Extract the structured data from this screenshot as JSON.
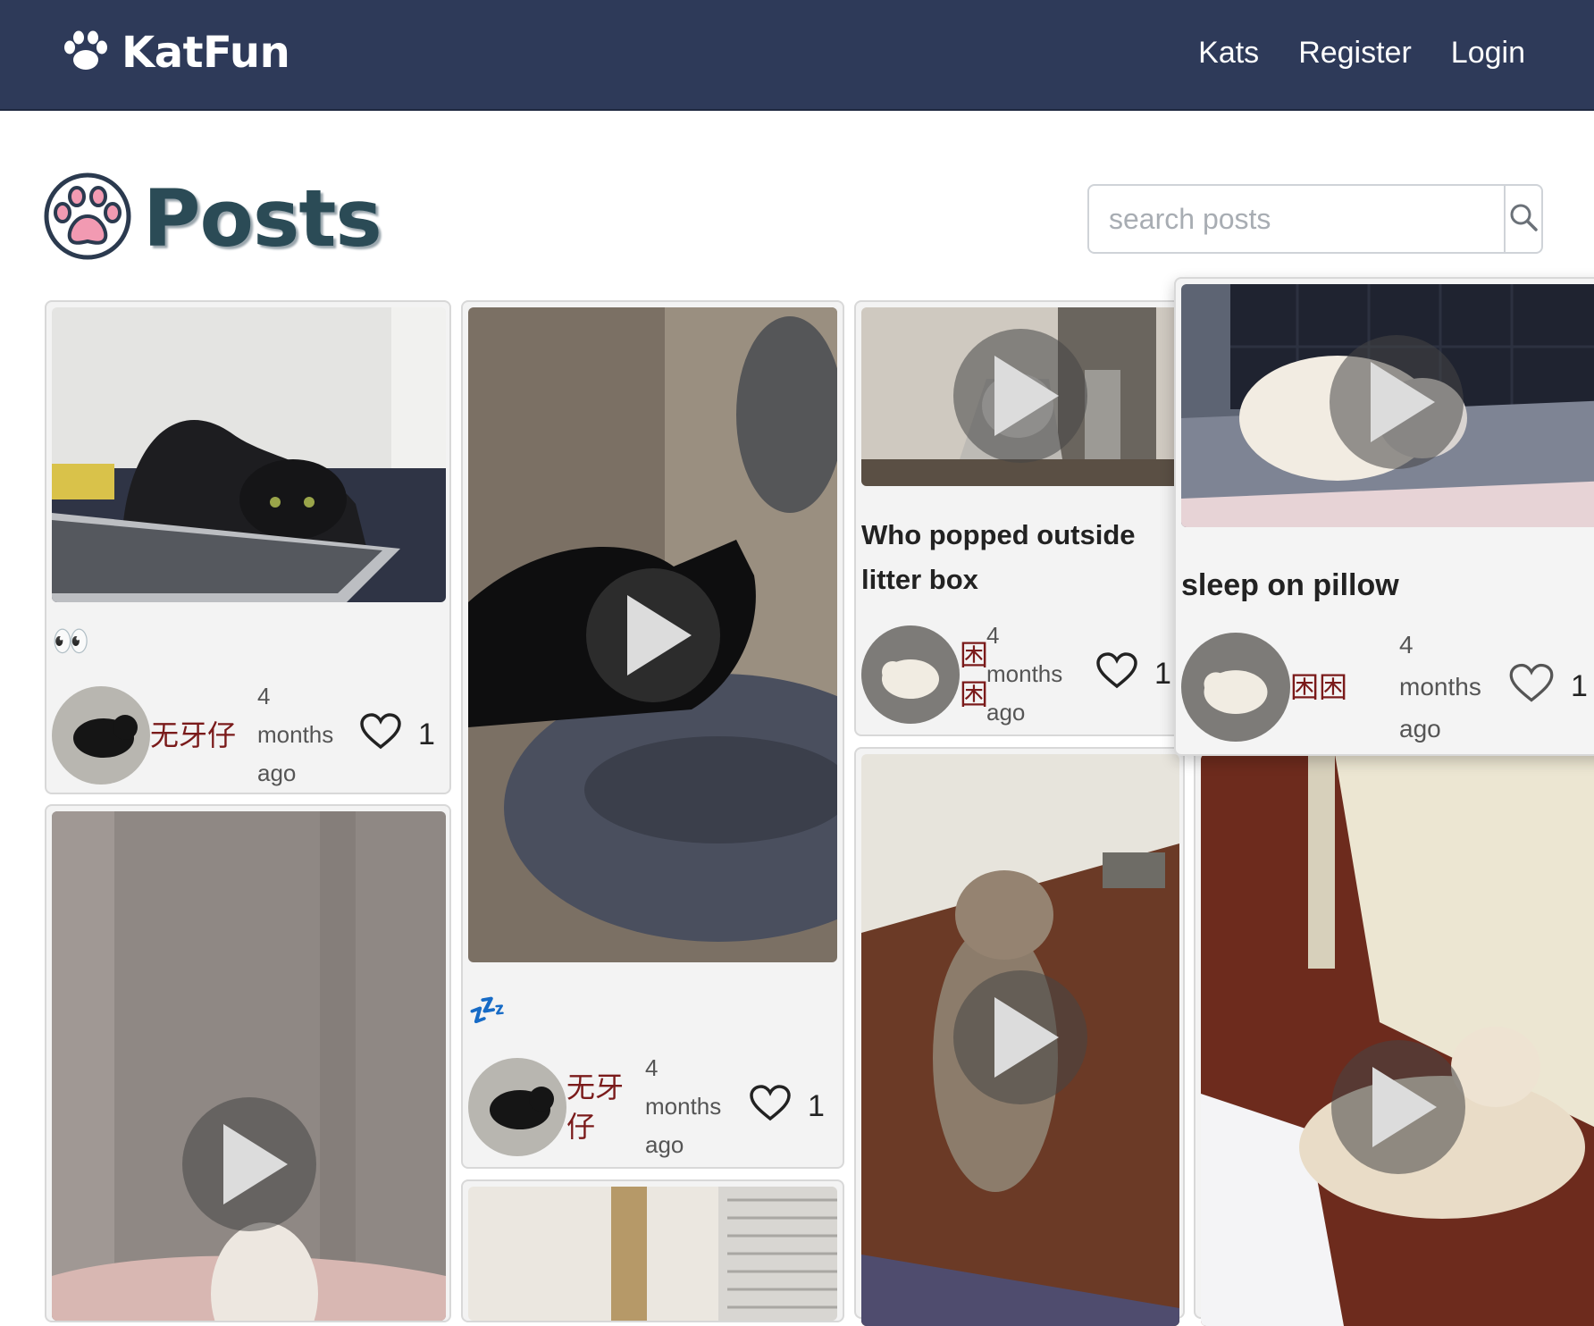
{
  "brand": {
    "name": "KatFun",
    "logo_icon": "paw-icon"
  },
  "nav": {
    "links": [
      "Kats",
      "Register",
      "Login"
    ]
  },
  "page": {
    "title": "Posts",
    "title_icon": "pink-paw-icon"
  },
  "search": {
    "placeholder": "search posts",
    "value": "",
    "icon": "search-icon"
  },
  "posts": [
    {
      "caption": "👀",
      "author": "无牙仔",
      "time": "4 months ago",
      "likes": "1",
      "media": "photo"
    },
    {
      "caption": "💤",
      "author": "无牙仔",
      "time": "4 months ago",
      "likes": "1",
      "media": "video"
    },
    {
      "caption": "Who popped outside litter box",
      "author": "困困",
      "time": "4 months ago",
      "likes": "1",
      "media": "video"
    },
    {
      "caption": "sleep on pillow",
      "author": "困困",
      "time": "4 months ago",
      "likes": "1",
      "media": "video"
    },
    {
      "caption": "",
      "author": "",
      "time": "",
      "likes": "",
      "media": "video"
    },
    {
      "caption": "",
      "author": "",
      "time": "",
      "likes": "",
      "media": "photo"
    },
    {
      "caption": "",
      "author": "",
      "time": "",
      "likes": "",
      "media": "video"
    },
    {
      "caption": "",
      "author": "",
      "time": "",
      "likes": "",
      "media": "video"
    }
  ]
}
